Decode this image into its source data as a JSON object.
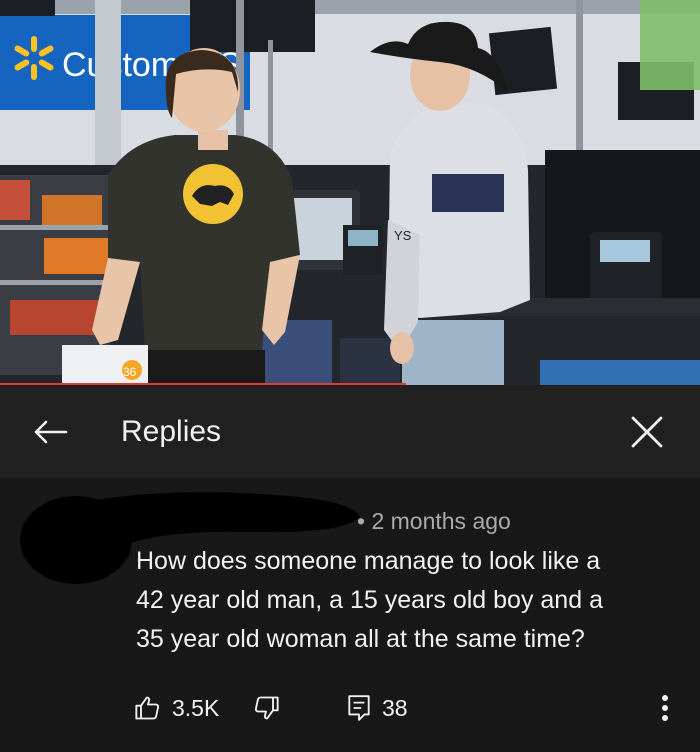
{
  "header": {
    "title": "Replies"
  },
  "photo": {
    "store_sign_text": "Customer S",
    "price_tag_text": "36",
    "jacket_text": "YS"
  },
  "comment": {
    "timestamp": "• 2 months ago",
    "text_lines": [
      "How does someone manage to look like a",
      "42 year old man, a 15 years old boy and a",
      "35 year old woman all at the same time?"
    ],
    "like_count": "3.5K",
    "reply_count": "38"
  },
  "video_progress": 0.58,
  "colors": {
    "header_bg": "#212121",
    "comment_bg": "#181818",
    "text": "#f1f1f1",
    "meta": "#aaaaaa",
    "progress": "#e53935",
    "brand_blue": "#1565c0",
    "brand_yellow": "#ffc220"
  },
  "icons": [
    "back-arrow-icon",
    "close-icon",
    "thumbs-up-icon",
    "thumbs-down-icon",
    "comment-icon",
    "more-vertical-icon"
  ]
}
